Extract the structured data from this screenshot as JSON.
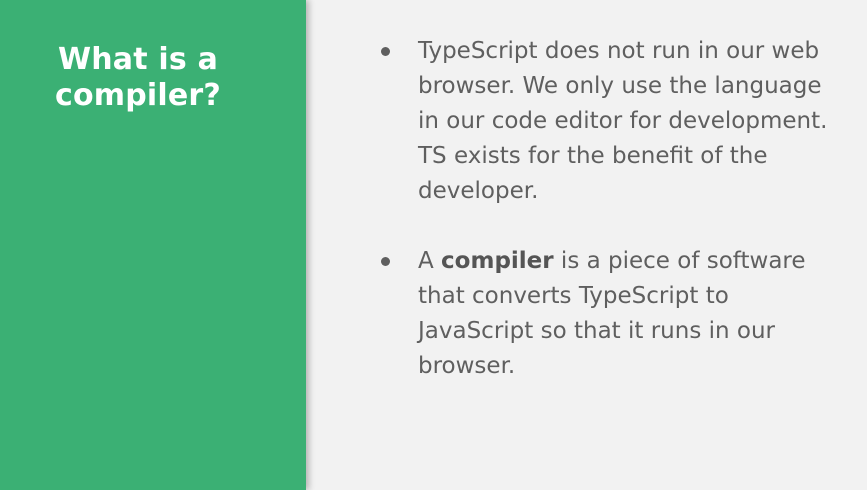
{
  "slide": {
    "title": "What is a compiler?",
    "bullets": [
      {
        "text": "TypeScript does not run in our web browser. We only use the language in our code editor for development. TS exists for the benefit of the developer."
      },
      {
        "prefix": "A ",
        "bold": "compiler",
        "suffix": " is a piece of software that converts TypeScript to JavaScript so that it runs in our browser."
      }
    ]
  },
  "colors": {
    "panel": "#3bb074",
    "background": "#f2f2f2",
    "text": "#5f5f5f"
  }
}
